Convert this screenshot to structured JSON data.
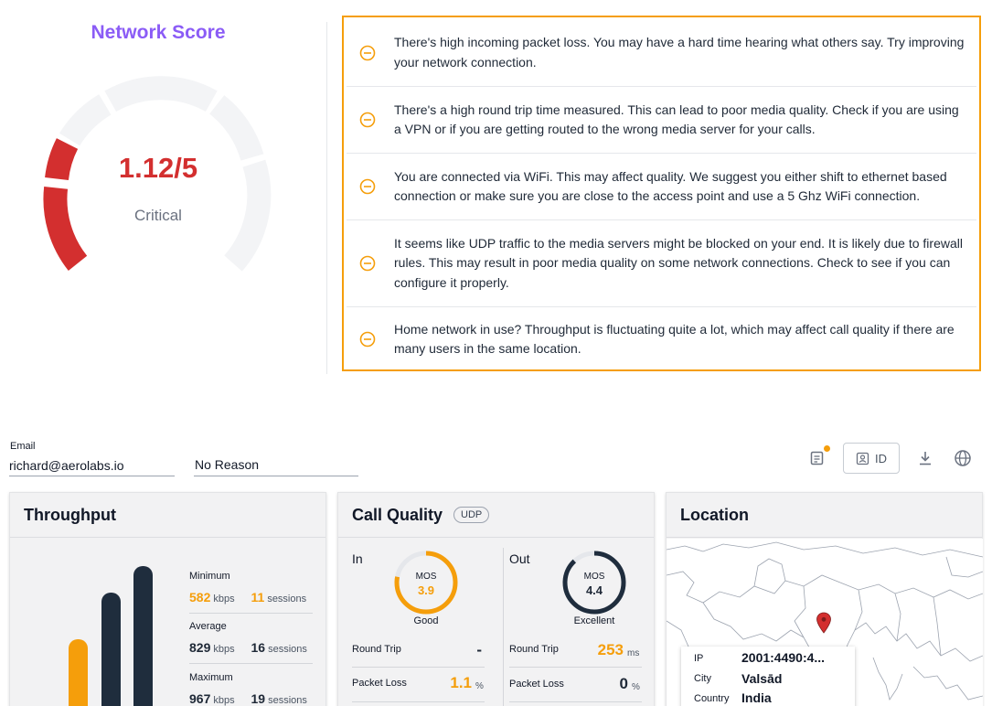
{
  "score": {
    "title": "Network Score",
    "value": "1.12/5",
    "level": 1.12,
    "max": 5,
    "label": "Critical",
    "color": "#d32f2f"
  },
  "issues": [
    {
      "icon": "minus-circle-icon",
      "text": "There's high incoming packet loss. You may have a hard time hearing what others say. Try improving your network connection."
    },
    {
      "icon": "minus-circle-icon",
      "text": "There's a high round trip time measured. This can lead to poor media quality. Check if you are using a VPN or if you are getting routed to the wrong media server for your calls."
    },
    {
      "icon": "minus-circle-icon",
      "text": "You are connected via WiFi. This may affect quality. We suggest you either shift to ethernet based connection or make sure you are close to the access point and use a 5 Ghz WiFi connection."
    },
    {
      "icon": "minus-circle-icon",
      "text": "It seems like UDP traffic to the media servers might be blocked on your end. It is likely due to firewall rules. This may result in poor media quality on some network connections. Check to see if you can configure it properly."
    },
    {
      "icon": "minus-circle-icon",
      "text": "Home network in use? Throughput is fluctuating quite a lot, which may affect call quality if there are many users in the same location."
    }
  ],
  "form": {
    "email_label": "Email",
    "email_value": "richard@aerolabs.io",
    "reason_value": "No Reason"
  },
  "toolbar": {
    "notes_icon": "notes-icon",
    "id_label": "ID",
    "download_icon": "download-icon",
    "globe_icon": "globe-icon",
    "accent": "#f59e0b"
  },
  "throughput": {
    "title": "Throughput",
    "minimum": {
      "label": "Minimum",
      "value": "582",
      "unit": "kbps",
      "sessions": "11",
      "sessions_label": "sessions"
    },
    "average": {
      "label": "Average",
      "value": "829",
      "unit": "kbps",
      "sessions": "16",
      "sessions_label": "sessions"
    },
    "maximum": {
      "label": "Maximum",
      "value": "967",
      "unit": "kbps",
      "sessions": "19",
      "sessions_label": "sessions"
    }
  },
  "call_quality": {
    "title": "Call Quality",
    "badge": "UDP",
    "in": {
      "label": "In",
      "mos_label": "MOS",
      "mos": "3.9",
      "mos_level": 3.9,
      "quality": "Good",
      "color": "#f59e0b"
    },
    "out": {
      "label": "Out",
      "mos_label": "MOS",
      "mos": "4.4",
      "mos_level": 4.4,
      "quality": "Excellent",
      "color": "#1f2d3d"
    },
    "rows": {
      "round_trip_label": "Round Trip",
      "packet_loss_label": "Packet Loss",
      "in_round_trip": "-",
      "in_packet_loss": "1.1",
      "in_packet_loss_unit": "%",
      "out_round_trip": "253",
      "out_round_trip_unit": "ms",
      "out_packet_loss": "0",
      "out_packet_loss_unit": "%"
    }
  },
  "location": {
    "title": "Location",
    "ip_label": "IP",
    "ip": "2001:4490:4...",
    "city_label": "City",
    "city": "Valsād",
    "country_label": "Country",
    "country": "India",
    "pin_icon": "map-pin-icon"
  }
}
